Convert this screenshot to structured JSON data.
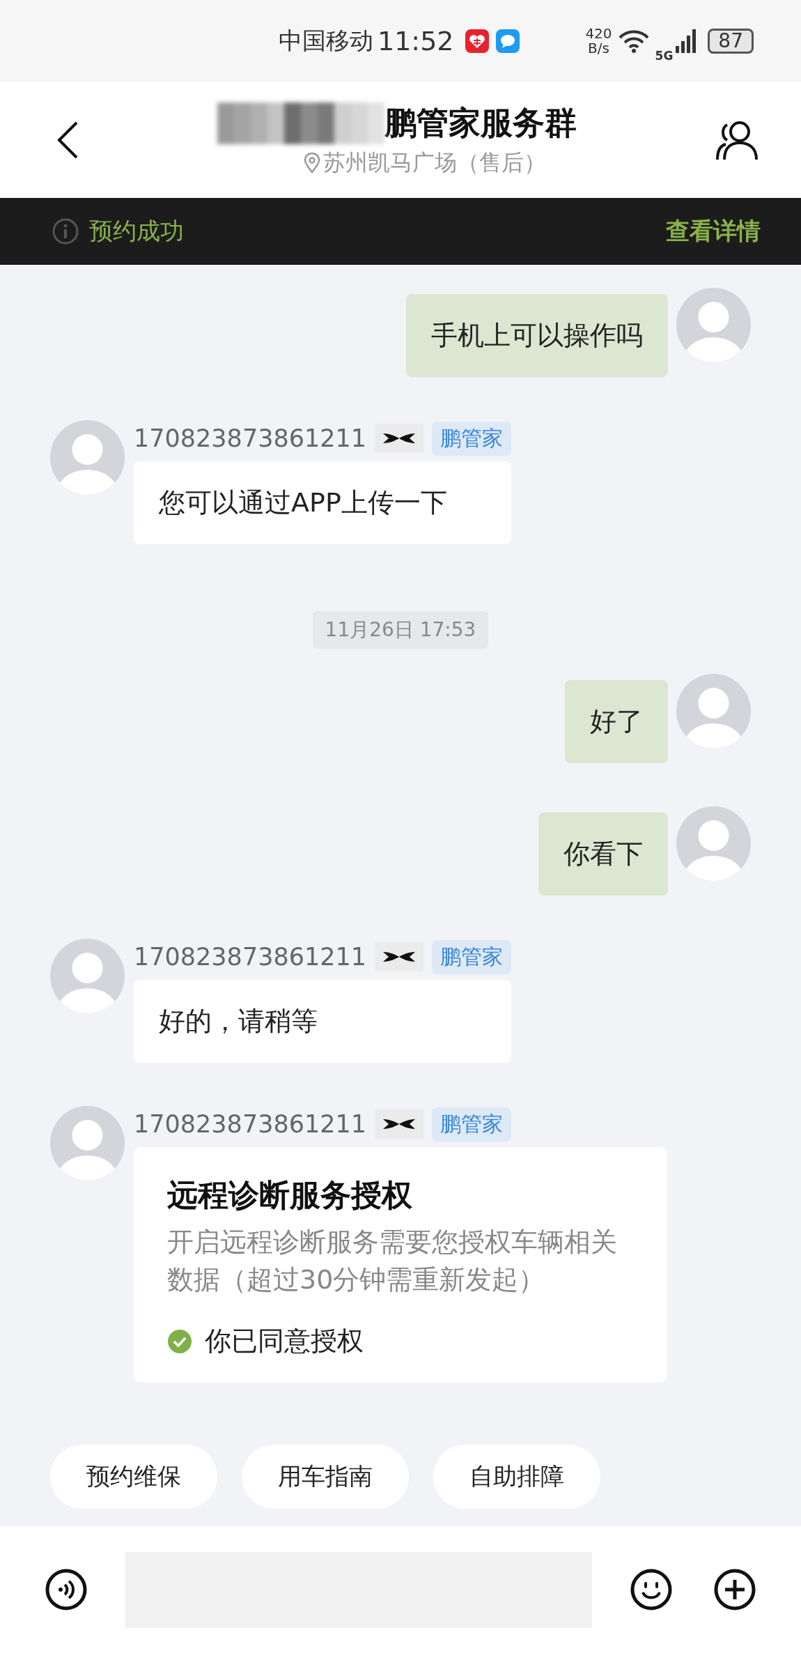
{
  "status_bar": {
    "carrier": "中国移动",
    "time": "11:52",
    "net_speed_value": "420",
    "net_speed_unit": "B/s",
    "network": "5G",
    "battery": "87"
  },
  "header": {
    "title": "鹏管家服务群",
    "location": "苏州凯马广场（售后）"
  },
  "notice": {
    "text": "预约成功",
    "action": "查看详情"
  },
  "messages": [
    {
      "kind": "outgoing",
      "text": "手机上可以操作吗"
    },
    {
      "kind": "incoming",
      "sender": "170823873861211",
      "tag": "鹏管家",
      "text": "您可以通过APP上传一下"
    },
    {
      "kind": "timestamp",
      "text": "11月26日 17:53"
    },
    {
      "kind": "outgoing",
      "text": "好了"
    },
    {
      "kind": "outgoing",
      "text": "你看下"
    },
    {
      "kind": "incoming",
      "sender": "170823873861211",
      "tag": "鹏管家",
      "text": "好的，请稍等"
    },
    {
      "kind": "card",
      "sender": "170823873861211",
      "tag": "鹏管家",
      "title": "远程诊断服务授权",
      "body": "开启远程诊断服务需要您授权车辆相关数据（超过30分钟需重新发起）",
      "agreed": true,
      "status": "你已同意授权"
    }
  ],
  "quick_replies": [
    "预约维保",
    "用车指南",
    "自助排障"
  ]
}
